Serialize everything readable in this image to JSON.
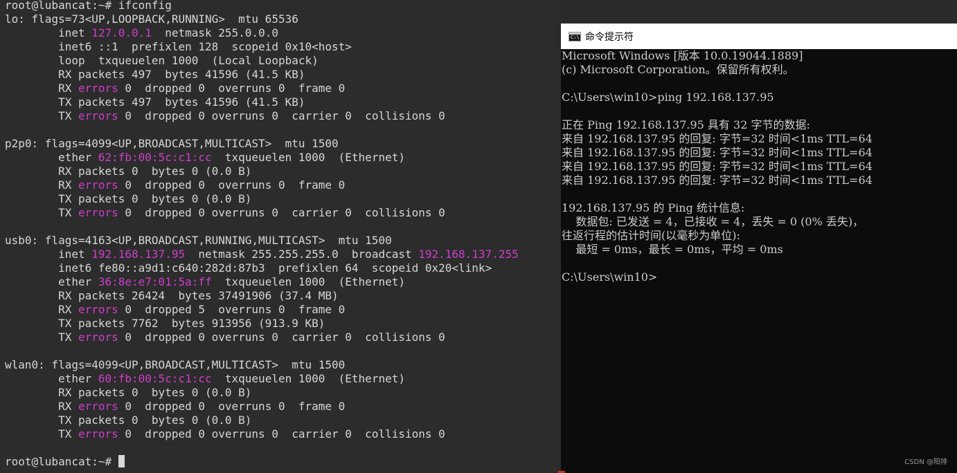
{
  "linux_terminal": {
    "lines": [
      [
        {
          "t": "root@lubancat:~# ifconfig"
        }
      ],
      [
        {
          "t": "lo: flags=73<UP,LOOPBACK,RUNNING>  mtu 65536"
        }
      ],
      [
        {
          "t": "        inet "
        },
        {
          "t": "127.0.0.1",
          "h": 1
        },
        {
          "t": "  netmask 255.0.0.0"
        }
      ],
      [
        {
          "t": "        inet6 ::1  prefixlen 128  scopeid 0x10<host>"
        }
      ],
      [
        {
          "t": "        loop  txqueuelen 1000  (Local Loopback)"
        }
      ],
      [
        {
          "t": "        RX packets 497  bytes 41596 (41.5 KB)"
        }
      ],
      [
        {
          "t": "        RX "
        },
        {
          "t": "errors",
          "h": 1
        },
        {
          "t": " 0  dropped 0  overruns 0  frame 0"
        }
      ],
      [
        {
          "t": "        TX packets 497  bytes 41596 (41.5 KB)"
        }
      ],
      [
        {
          "t": "        TX "
        },
        {
          "t": "errors",
          "h": 1
        },
        {
          "t": " 0  dropped 0 overruns 0  carrier 0  collisions 0"
        }
      ],
      [
        {
          "t": ""
        }
      ],
      [
        {
          "t": "p2p0: flags=4099<UP,BROADCAST,MULTICAST>  mtu 1500"
        }
      ],
      [
        {
          "t": "        ether "
        },
        {
          "t": "62:fb:00:5c:c1:cc",
          "h": 1
        },
        {
          "t": "  txqueuelen 1000  (Ethernet)"
        }
      ],
      [
        {
          "t": "        RX packets 0  bytes 0 (0.0 B)"
        }
      ],
      [
        {
          "t": "        RX "
        },
        {
          "t": "errors",
          "h": 1
        },
        {
          "t": " 0  dropped 0  overruns 0  frame 0"
        }
      ],
      [
        {
          "t": "        TX packets 0  bytes 0 (0.0 B)"
        }
      ],
      [
        {
          "t": "        TX "
        },
        {
          "t": "errors",
          "h": 1
        },
        {
          "t": " 0  dropped 0 overruns 0  carrier 0  collisions 0"
        }
      ],
      [
        {
          "t": ""
        }
      ],
      [
        {
          "t": "usb0: flags=4163<UP,BROADCAST,RUNNING,MULTICAST>  mtu 1500"
        }
      ],
      [
        {
          "t": "        inet "
        },
        {
          "t": "192.168.137.95",
          "h": 1
        },
        {
          "t": "  netmask 255.255.255.0  broadcast "
        },
        {
          "t": "192.168.137.255",
          "h": 1
        }
      ],
      [
        {
          "t": "        inet6 fe80::a9d1:c640:282d:87b3  prefixlen 64  scopeid 0x20<link>"
        }
      ],
      [
        {
          "t": "        ether "
        },
        {
          "t": "36:8e:e7:01:5a:ff",
          "h": 1
        },
        {
          "t": "  txqueuelen 1000  (Ethernet)"
        }
      ],
      [
        {
          "t": "        RX packets 26424  bytes 37491906 (37.4 MB)"
        }
      ],
      [
        {
          "t": "        RX "
        },
        {
          "t": "errors",
          "h": 1
        },
        {
          "t": " 0  dropped 5  overruns 0  frame 0"
        }
      ],
      [
        {
          "t": "        TX packets 7762  bytes 913956 (913.9 KB)"
        }
      ],
      [
        {
          "t": "        TX "
        },
        {
          "t": "errors",
          "h": 1
        },
        {
          "t": " 0  dropped 0 overruns 0  carrier 0  collisions 0"
        }
      ],
      [
        {
          "t": ""
        }
      ],
      [
        {
          "t": "wlan0: flags=4099<UP,BROADCAST,MULTICAST>  mtu 1500"
        }
      ],
      [
        {
          "t": "        ether "
        },
        {
          "t": "60:fb:00:5c:c1:cc",
          "h": 1
        },
        {
          "t": "  txqueuelen 1000  (Ethernet)"
        }
      ],
      [
        {
          "t": "        RX packets 0  bytes 0 (0.0 B)"
        }
      ],
      [
        {
          "t": "        RX "
        },
        {
          "t": "errors",
          "h": 1
        },
        {
          "t": " 0  dropped 0  overruns 0  frame 0"
        }
      ],
      [
        {
          "t": "        TX packets 0  bytes 0 (0.0 B)"
        }
      ],
      [
        {
          "t": "        TX "
        },
        {
          "t": "errors",
          "h": 1
        },
        {
          "t": " 0  dropped 0 overruns 0  carrier 0  collisions 0"
        }
      ],
      [
        {
          "t": ""
        }
      ],
      [
        {
          "t": "root@lubancat:~# "
        },
        {
          "cursor": 1
        }
      ]
    ]
  },
  "cmd_window": {
    "title": "命令提示符",
    "icon_label": "C:\\",
    "lines": [
      "Microsoft Windows [版本 10.0.19044.1889]",
      "(c) Microsoft Corporation。保留所有权利。",
      "",
      "C:\\Users\\win10>ping 192.168.137.95",
      "",
      "正在 Ping 192.168.137.95 具有 32 字节的数据:",
      "来自 192.168.137.95 的回复: 字节=32 时间<1ms TTL=64",
      "来自 192.168.137.95 的回复: 字节=32 时间<1ms TTL=64",
      "来自 192.168.137.95 的回复: 字节=32 时间<1ms TTL=64",
      "来自 192.168.137.95 的回复: 字节=32 时间<1ms TTL=64",
      "",
      "192.168.137.95 的 Ping 统计信息:",
      "    数据包: 已发送 = 4，已接收 = 4，丢失 = 0 (0% 丢失)，",
      "往返行程的估计时间(以毫秒为单位):",
      "    最短 = 0ms，最长 = 0ms，平均 = 0ms",
      "",
      "C:\\Users\\win10>"
    ]
  },
  "watermark": "CSDN @阳排",
  "colors": {
    "linux_bg": "#2c2c2c",
    "linux_text": "#d6d6d6",
    "highlight": "#ce3ecb",
    "cmd_bg": "#0c0c0c",
    "cmd_text": "#cccccc"
  }
}
